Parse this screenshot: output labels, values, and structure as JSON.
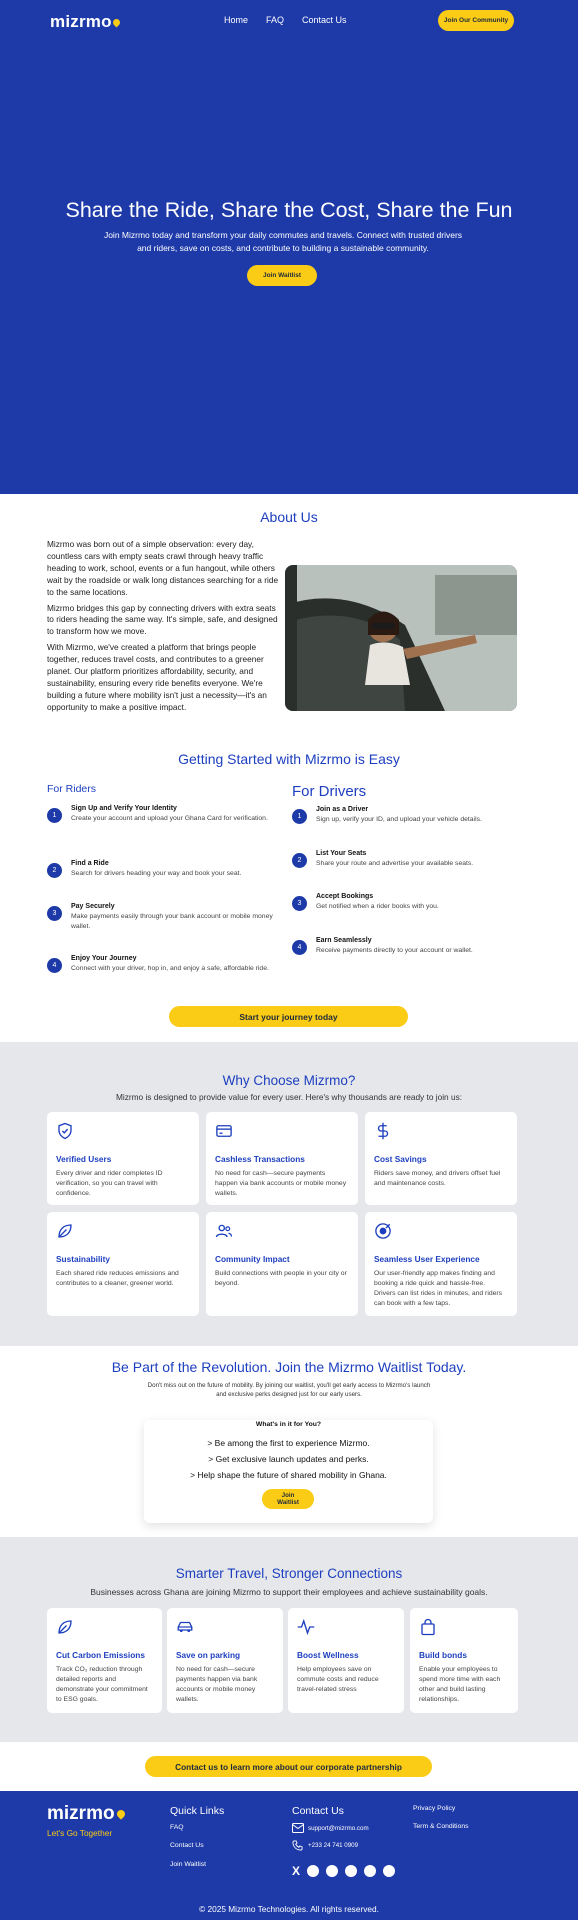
{
  "nav": {
    "logo": "mizrmo",
    "links": [
      "Home",
      "FAQ",
      "Contact Us"
    ],
    "cta": "Join Our Community"
  },
  "hero": {
    "title": "Share the Ride, Share the Cost, Share the Fun",
    "subtitle": "Join Mizrmo today and transform your daily commutes and travels.   Connect with trusted drivers and riders, save on costs, and contribute to building a sustainable community.",
    "button": "Join Waitlist"
  },
  "about": {
    "title": "About Us",
    "paragraphs": [
      "Mizrmo was born out of a simple observation: every day, countless cars with empty seats crawl through heavy traffic heading to work, school, events or a fun hangout, while others wait by the roadside or walk long distances searching for a ride to the same locations.",
      "Mizrmo bridges this gap by connecting drivers with extra seats to riders heading the same way. It's simple, safe, and designed to transform how we move.",
      "With Mizrmo, we've created a platform that brings people together, reduces travel costs, and contributes to a greener planet. Our platform prioritizes affordability, security, and sustainability, ensuring every ride benefits everyone. We're building a future where mobility isn't just a necessity—it's an opportunity to make a positive impact."
    ]
  },
  "started": {
    "title": "Getting Started with Mizrmo is Easy",
    "riders_title": "For Riders",
    "drivers_title": "For Drivers",
    "riders": [
      {
        "n": "1",
        "t": "Sign Up and Verify Your Identity",
        "d": "Create your account and upload your Ghana Card for verification."
      },
      {
        "n": "2",
        "t": "Find a Ride",
        "d": "Search for drivers heading your way and book your seat."
      },
      {
        "n": "3",
        "t": "Pay Securely",
        "d": "Make payments easily through your bank account or mobile money wallet."
      },
      {
        "n": "4",
        "t": "Enjoy Your Journey",
        "d": "Connect with your driver, hop in, and enjoy a safe, affordable ride."
      }
    ],
    "drivers": [
      {
        "n": "1",
        "t": "Join as a Driver",
        "d": "Sign up, verify your ID, and upload your vehicle details."
      },
      {
        "n": "2",
        "t": "List Your Seats",
        "d": "Share your route and advertise your available seats."
      },
      {
        "n": "3",
        "t": "Accept Bookings",
        "d": "Get notified when a rider books with you."
      },
      {
        "n": "4",
        "t": "Earn Seamlessly",
        "d": "Receive payments directly to your account or wallet."
      }
    ],
    "button": "Start your journey today"
  },
  "why": {
    "title": "Why Choose Mizrmo?",
    "subtitle": "Mizrmo is designed to provide value for every user. Here's why thousands are ready to join us:",
    "cards": [
      {
        "icon": "shield-check-icon",
        "t": "Verified Users",
        "d": "Every driver and rider completes ID verification, so you can travel with confidence."
      },
      {
        "icon": "credit-card-icon",
        "t": "Cashless Transactions",
        "d": "No need for cash—secure payments happen via bank accounts or mobile money wallets."
      },
      {
        "icon": "dollar-icon",
        "t": "Cost Savings",
        "d": "Riders save money, and drivers offset fuel and maintenance costs."
      },
      {
        "icon": "leaf-icon",
        "t": "Sustainability",
        "d": "Each shared ride reduces emissions and contributes to a cleaner, greener world."
      },
      {
        "icon": "users-icon",
        "t": "Community Impact",
        "d": "Build connections with people in your city or beyond."
      },
      {
        "icon": "target-icon",
        "t": "Seamless User Experience",
        "d": "Our user-friendly app makes finding and booking a ride quick and hassle-free. Drivers can list rides in minutes, and riders can book with a few taps."
      }
    ]
  },
  "waitlist": {
    "title": "Be Part of the Revolution. Join the Mizrmo Waitlist Today.",
    "subtitle": "Don't miss out on the future of mobility. By joining our waitlist, you'll get early access to Mizrmo's launch and exclusive perks designed just for our early users.",
    "card_title": "What's in it for You?",
    "items": [
      "Be among the first to experience Mizrmo.",
      "Get exclusive launch updates and perks.",
      "Help shape the future of shared mobility in Ghana."
    ],
    "button": "Join Waitlist"
  },
  "corporate": {
    "title": "Smarter Travel, Stronger Connections",
    "subtitle": "Businesses across Ghana are joining Mizrmo to support their employees and achieve sustainability goals.",
    "cards": [
      {
        "icon": "leaf-icon",
        "t": "Cut Carbon Emissions",
        "d": "Track CO₂ reduction through detailed reports and demonstrate your commitment to ESG goals."
      },
      {
        "icon": "car-icon",
        "t": "Save on parking",
        "d": "No need for cash—secure payments happen via bank accounts or mobile money wallets."
      },
      {
        "icon": "pulse-icon",
        "t": "Boost Wellness",
        "d": "Help employees save on commute costs and reduce travel-related stress"
      },
      {
        "icon": "bag-icon",
        "t": "Build bonds",
        "d": "Enable your employees to spend more time with each other and build lasting relationships."
      }
    ],
    "button": "Contact us to learn more about our corporate partnership"
  },
  "footer": {
    "logo": "mizrmo",
    "tagline": "Let's Go Together",
    "quick_title": "Quick Links",
    "quick": [
      "FAQ",
      "Contact Us",
      "Join Waitlist"
    ],
    "contact_title": "Contact Us",
    "email": "support@mizrmo.com",
    "phone": "+233 24 741 0909",
    "legal": [
      "Privacy Policy",
      "Term & Conditions"
    ],
    "copyright": "© 2025 Mizrmo Technologies. All rights reserved.",
    "social": [
      "x-icon",
      "facebook-icon",
      "linkedin-icon",
      "instagram-icon",
      "tiktok-icon",
      "snapchat-icon"
    ]
  },
  "colors": {
    "primary": "#1e3aa8",
    "accent": "#facc15",
    "heading": "#1d3fbf"
  }
}
